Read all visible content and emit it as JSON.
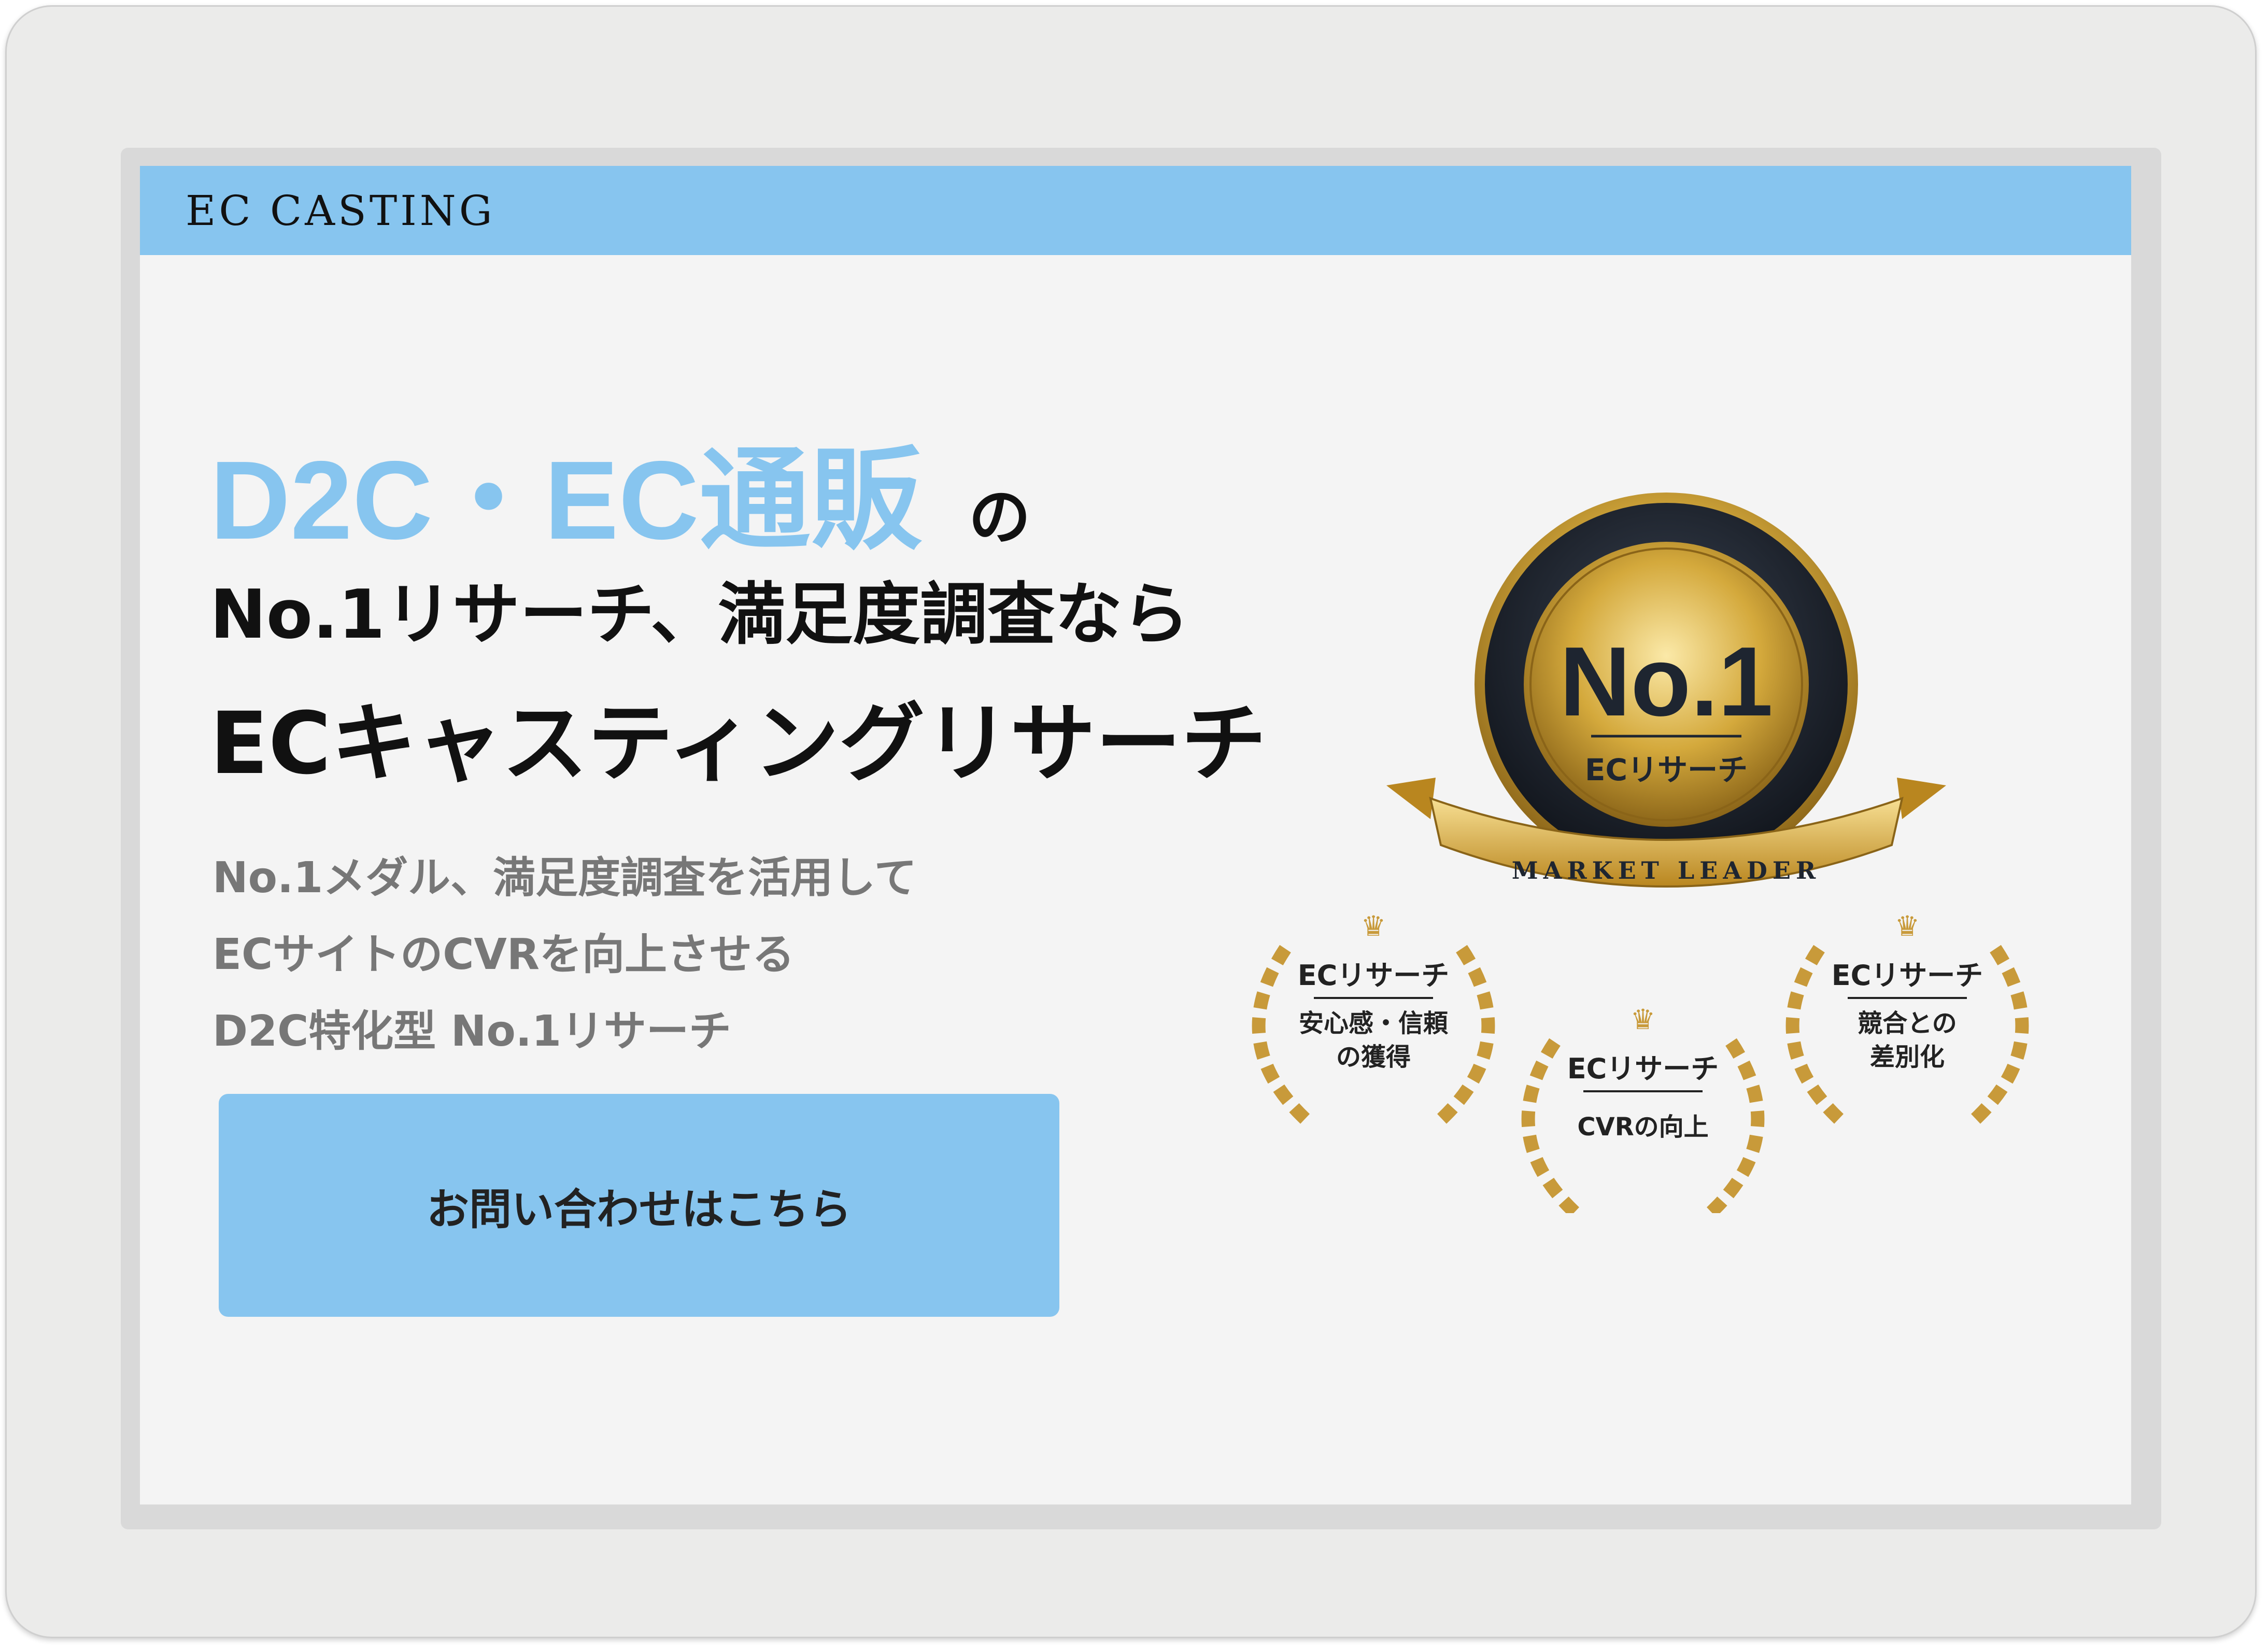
{
  "header": {
    "brand": "EC CASTING"
  },
  "hero": {
    "accent": "D2C・EC通販",
    "particle": "の",
    "line2": "No.1リサーチ、満足度調査なら",
    "line3": "ECキャスティングリサーチ"
  },
  "subtext": [
    "No.1メダル、満足度調査を活用して",
    "ECサイトのCVRを向上させる",
    "D2C特化型 No.1リサーチ"
  ],
  "cta": {
    "label": "お問い合わせはこちら"
  },
  "medal_main": {
    "title": "No.1",
    "subtitle": "ECリサーチ",
    "ribbon": "MARKET LEADER"
  },
  "laurels": [
    {
      "title": "ECリサーチ",
      "lines": [
        "安心感・信頼",
        "の獲得"
      ]
    },
    {
      "title": "ECリサーチ",
      "lines": [
        "CVRの向上"
      ]
    },
    {
      "title": "ECリサーチ",
      "lines": [
        "競合との",
        "差別化"
      ]
    }
  ],
  "colors": {
    "accent": "#87c5ef",
    "gold": "#d4a93c",
    "dark": "#1e2530"
  }
}
